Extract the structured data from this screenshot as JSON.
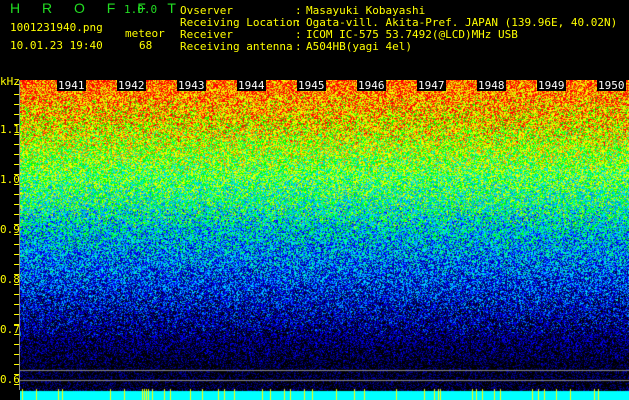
{
  "app": {
    "title": "H R O F F T",
    "version": "1.0.0"
  },
  "file": {
    "name": "1001231940.png",
    "datetime": "10.01.23 19:40"
  },
  "meteor": {
    "label": "meteor",
    "count": "68"
  },
  "info": {
    "observer_label": "Ovserver",
    "observer": "Masayuki Kobayashi",
    "location_label": "Receiving Location",
    "location": "Ogata-vill. Akita-Pref. JAPAN (139.96E, 40.02N)",
    "receiver_label": "Receiver",
    "receiver": "ICOM IC-575 53.7492(@LCD)MHz USB",
    "antenna_label": "Receiving antenna",
    "antenna": "A504HB(yagi 4el)",
    "sep": ":"
  },
  "axis": {
    "unit": "kHz",
    "labels": [
      "1.1",
      "1.0",
      "0.9",
      "0.8",
      "0.7",
      "0.6"
    ]
  },
  "minutes": [
    "1941",
    "1942",
    "1943",
    "1944",
    "1945",
    "1946",
    "1947",
    "1948",
    "1949",
    "1950"
  ]
}
